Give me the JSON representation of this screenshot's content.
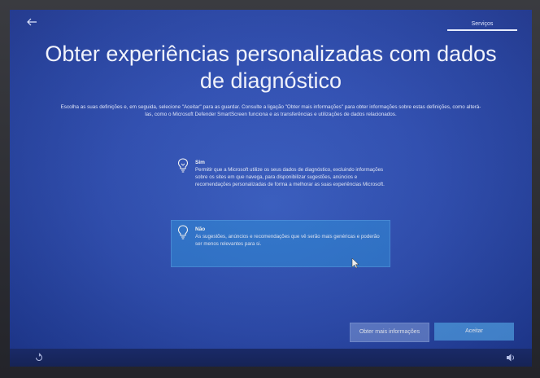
{
  "header": {
    "back_icon": "back-arrow-icon",
    "tab_label": "Serviços"
  },
  "title": "Obter experiências personalizadas com dados de diagnóstico",
  "description": "Escolha as suas definições e, em seguida, selecione \"Aceitar\" para as guardar. Consulte a ligação \"Obter mais informações\" para obter informações sobre estas definições, como alterá-las, como o Microsoft Defender SmartScreen funciona e as transferências e utilizações de dados relacionados.",
  "options": [
    {
      "title": "Sim",
      "body": "Permitir que a Microsoft utilize os seus dados de diagnóstico, excluindo informações sobre os sites em que navega, para disponibilizar sugestões, anúncios e recomendações personalizadas de forma a melhorar as suas experiências Microsoft.",
      "icon": "lightbulb-on-icon",
      "selected": false
    },
    {
      "title": "Não",
      "body": "As sugestões, anúncios e recomendações que vê serão mais genéricas e poderão ser menos relevantes para si.",
      "icon": "lightbulb-off-icon",
      "selected": true
    }
  ],
  "buttons": {
    "more_info": "Obter mais informações",
    "accept": "Aceitar"
  },
  "footer": {
    "ease_icon": "ease-of-access-icon",
    "volume_icon": "volume-icon"
  },
  "colors": {
    "background": "#2f4fb5",
    "selected_option": "#3296e6",
    "accept_button": "#50a0eb"
  }
}
